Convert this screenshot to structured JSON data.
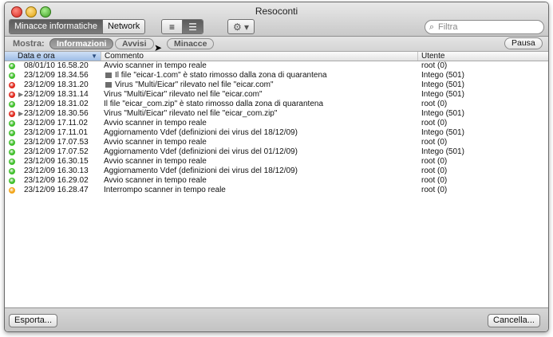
{
  "window": {
    "title": "Resoconti"
  },
  "toolbar": {
    "view_toggle": [
      "Minacce informatiche",
      "Network"
    ],
    "selected_view": 0,
    "gear_label": "⚙ ▾",
    "search": {
      "placeholder": "Filtra",
      "value": ""
    }
  },
  "filter_bar": {
    "label": "Mostra:",
    "filters": [
      {
        "label": "Informazioni",
        "active": true
      },
      {
        "label": "Avvisi",
        "active": false
      },
      {
        "label": "Minacce",
        "active": false
      }
    ],
    "pause_label": "Pausa"
  },
  "table": {
    "columns": [
      "Data e ora",
      "Commento",
      "Utente"
    ],
    "sorted_column": 0,
    "rows": [
      {
        "status": "green",
        "expand": false,
        "child": false,
        "file_icon": false,
        "date": "08/01/10 16.58.20",
        "comment": "Avvio scanner in tempo reale",
        "user": "root (0)"
      },
      {
        "status": "green",
        "expand": false,
        "child": true,
        "file_icon": true,
        "date": "23/12/09 18.34.56",
        "comment": "Il file \"eicar-1.com\" è stato rimosso dalla zona di quarantena",
        "user": "Intego (501)"
      },
      {
        "status": "red",
        "expand": false,
        "child": true,
        "file_icon": true,
        "date": "23/12/09 18.31.20",
        "comment": "Virus \"Multi/Eicar\" rilevato nel file \"eicar.com\"",
        "user": "Intego (501)"
      },
      {
        "status": "red",
        "expand": true,
        "child": false,
        "file_icon": false,
        "date": "23/12/09 18.31.14",
        "comment": "Virus \"Multi/Eicar\" rilevato nel file \"eicar.com\"",
        "user": "Intego (501)"
      },
      {
        "status": "green",
        "expand": false,
        "child": false,
        "file_icon": false,
        "date": "23/12/09 18.31.02",
        "comment": "Il file \"eicar_com.zip\" è stato rimosso dalla zona di quarantena",
        "user": "root (0)"
      },
      {
        "status": "red",
        "expand": true,
        "child": false,
        "file_icon": false,
        "date": "23/12/09 18.30.56",
        "comment": "Virus \"Multi/Eicar\" rilevato nel file \"eicar_com.zip\"",
        "user": "Intego (501)"
      },
      {
        "status": "green",
        "expand": false,
        "child": false,
        "file_icon": false,
        "date": "23/12/09 17.11.02",
        "comment": "Avvio scanner in tempo reale",
        "user": "root (0)"
      },
      {
        "status": "green",
        "expand": false,
        "child": false,
        "file_icon": false,
        "date": "23/12/09 17.11.01",
        "comment": "Aggiornamento Vdef (definizioni dei virus del 18/12/09)",
        "user": "Intego (501)"
      },
      {
        "status": "green",
        "expand": false,
        "child": false,
        "file_icon": false,
        "date": "23/12/09 17.07.53",
        "comment": "Avvio scanner in tempo reale",
        "user": "root (0)"
      },
      {
        "status": "green",
        "expand": false,
        "child": false,
        "file_icon": false,
        "date": "23/12/09 17.07.52",
        "comment": "Aggiornamento Vdef (definizioni dei virus del 01/12/09)",
        "user": "Intego (501)"
      },
      {
        "status": "green",
        "expand": false,
        "child": false,
        "file_icon": false,
        "date": "23/12/09 16.30.15",
        "comment": "Avvio scanner in tempo reale",
        "user": "root (0)"
      },
      {
        "status": "green",
        "expand": false,
        "child": false,
        "file_icon": false,
        "date": "23/12/09 16.30.13",
        "comment": "Aggiornamento Vdef (definizioni dei virus del 18/12/09)",
        "user": "root (0)"
      },
      {
        "status": "green",
        "expand": false,
        "child": false,
        "file_icon": false,
        "date": "23/12/09 16.29.02",
        "comment": "Avvio scanner in tempo reale",
        "user": "root (0)"
      },
      {
        "status": "orange",
        "expand": false,
        "child": false,
        "file_icon": false,
        "date": "23/12/09 16.28.47",
        "comment": "Interrompo scanner in tempo reale",
        "user": "root (0)"
      }
    ]
  },
  "footer": {
    "export_label": "Esporta...",
    "delete_label": "Cancella..."
  },
  "colors": {
    "green": "#3fbf2a",
    "red": "#e0281c",
    "orange": "#f2a51a",
    "sorted_header": "#a9c4ea"
  }
}
